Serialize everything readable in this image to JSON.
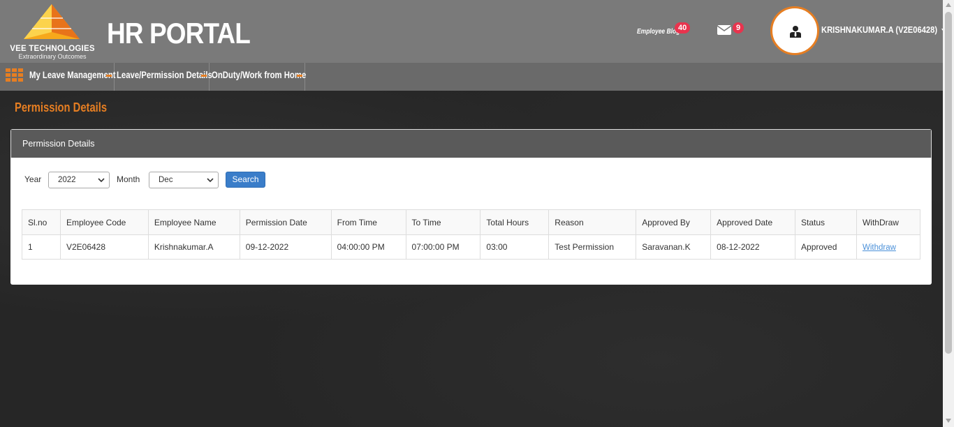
{
  "brand": {
    "company": "VEE TECHNOLOGIES",
    "tagline": "Extraordinary Outcomes",
    "portal_title": "HR PORTAL",
    "accent": "#e67e22"
  },
  "header": {
    "blog_label": "Employee Blog",
    "blog_count": "40",
    "mail_count": "9",
    "user_name": "KRISHNAKUMAR.A (V2E06428)"
  },
  "nav": {
    "items": [
      {
        "label": "My Leave Management"
      },
      {
        "label": "Leave/Permission Details"
      },
      {
        "label": "OnDuty/Work from Home"
      }
    ]
  },
  "page": {
    "title": "Permission Details",
    "panel_title": "Permission Details"
  },
  "filters": {
    "year_label": "Year",
    "year_value": "2022",
    "month_label": "Month",
    "month_value": "Dec",
    "search_label": "Search"
  },
  "table": {
    "columns": [
      "Sl.no",
      "Employee Code",
      "Employee Name",
      "Permission Date",
      "From Time",
      "To Time",
      "Total Hours",
      "Reason",
      "Approved By",
      "Approved Date",
      "Status",
      "WithDraw"
    ],
    "rows": [
      {
        "slno": "1",
        "employee_code": "V2E06428",
        "employee_name": "Krishnakumar.A",
        "permission_date": "09-12-2022",
        "from_time": "04:00:00 PM",
        "to_time": "07:00:00 PM",
        "total_hours": "03:00",
        "reason": "Test Permission",
        "approved_by": "Saravanan.K",
        "approved_date": "08-12-2022",
        "status": "Approved",
        "withdraw": "Withdraw"
      }
    ]
  }
}
